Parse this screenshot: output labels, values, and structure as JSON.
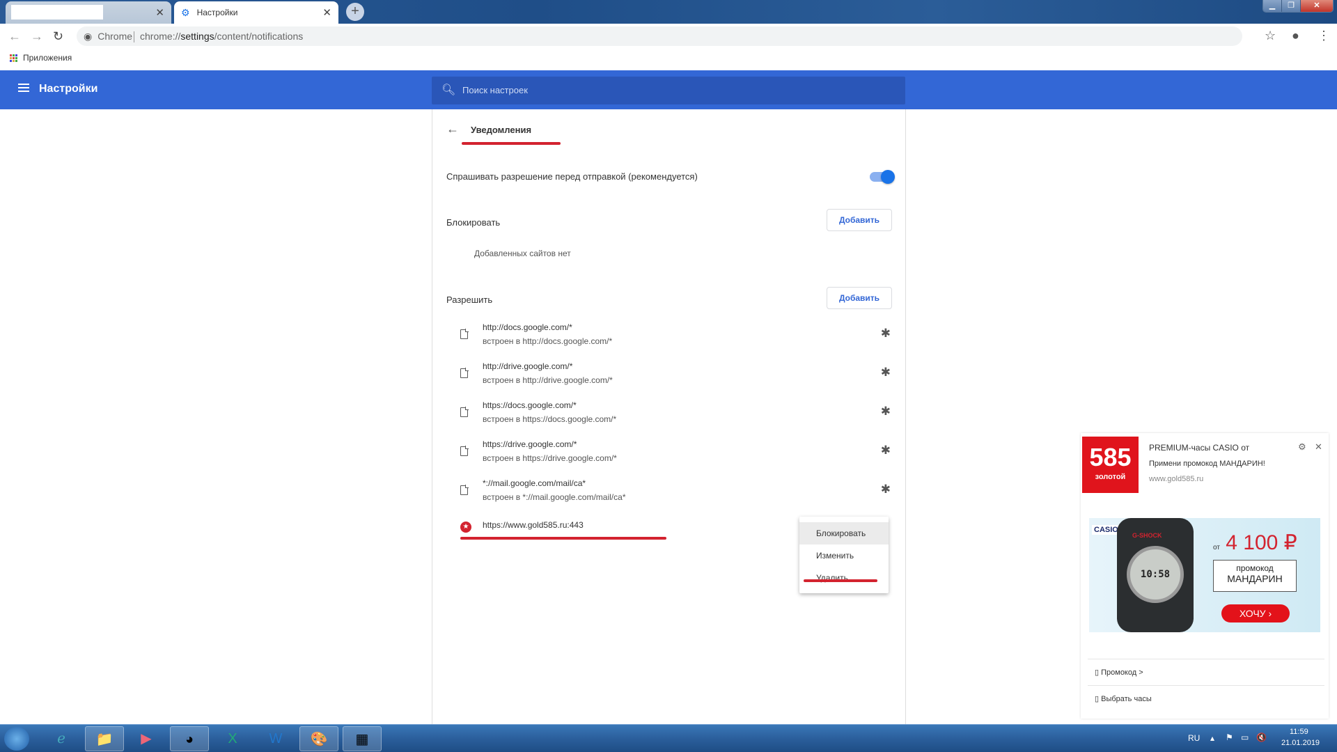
{
  "browser": {
    "tabs": [
      {
        "label": "",
        "state": "inactive"
      },
      {
        "label": "Настройки",
        "state": "active"
      }
    ],
    "omnibox": {
      "chip": "Chrome",
      "url_prefix": "chrome://",
      "url_host": "settings",
      "url_path": "/content/notifications"
    },
    "bookmarks": {
      "apps_label": "Приложения"
    }
  },
  "header": {
    "title": "Настройки",
    "search_placeholder": "Поиск настроек"
  },
  "page": {
    "title": "Уведомления",
    "ask_setting": {
      "label": "Спрашивать разрешение перед отправкой (рекомендуется)",
      "enabled": true
    },
    "block_section": {
      "label": "Блокировать",
      "add_button": "Добавить",
      "empty_text": "Добавленных сайтов нет"
    },
    "allow_section": {
      "label": "Разрешить",
      "add_button": "Добавить",
      "sites": [
        {
          "url": "http://docs.google.com/*",
          "sub": "встроен в http://docs.google.com/*",
          "icon": "file-icon",
          "action_icon": "extension-puzzle-icon"
        },
        {
          "url": "http://drive.google.com/*",
          "sub": "встроен в http://drive.google.com/*",
          "icon": "file-icon",
          "action_icon": "extension-puzzle-icon"
        },
        {
          "url": "https://docs.google.com/*",
          "sub": "встроен в https://docs.google.com/*",
          "icon": "file-icon",
          "action_icon": "extension-puzzle-icon"
        },
        {
          "url": "https://drive.google.com/*",
          "sub": "встроен в https://drive.google.com/*",
          "icon": "file-icon",
          "action_icon": "extension-puzzle-icon"
        },
        {
          "url": "*://mail.google.com/mail/ca*",
          "sub": "встроен в *://mail.google.com/mail/ca*",
          "icon": "file-icon",
          "action_icon": "extension-puzzle-icon"
        },
        {
          "url": "https://www.gold585.ru:443",
          "sub": "",
          "icon": "site-favicon-star-icon",
          "action_icon": ""
        }
      ]
    },
    "context_menu": {
      "items": [
        "Блокировать",
        "Изменить",
        "Удалить"
      ],
      "hovered": "Блокировать"
    }
  },
  "notification": {
    "logo_number": "585",
    "logo_text": "золотой",
    "title": "PREMIUM-часы CASIO от",
    "message": "Примени промокод МАНДАРИН!",
    "source": "www.gold585.ru",
    "banner": {
      "brand": "CASIO",
      "watch_brand": "G-SHOCK",
      "watch_time": "10:58",
      "price_prefix": "от",
      "price": "4 100 ₽",
      "promo_label": "промокод",
      "promo_code": "МАНДАРИН",
      "cta": "ХОЧУ ›"
    },
    "links": [
      "▯ Промокод >",
      "▯ Выбрать часы"
    ]
  },
  "taskbar": {
    "language": "RU",
    "time": "11:59",
    "date": "21.01.2019"
  },
  "colors": {
    "accent": "#3367d6",
    "annotation": "#d3232f",
    "toggle": "#1a73e8"
  }
}
